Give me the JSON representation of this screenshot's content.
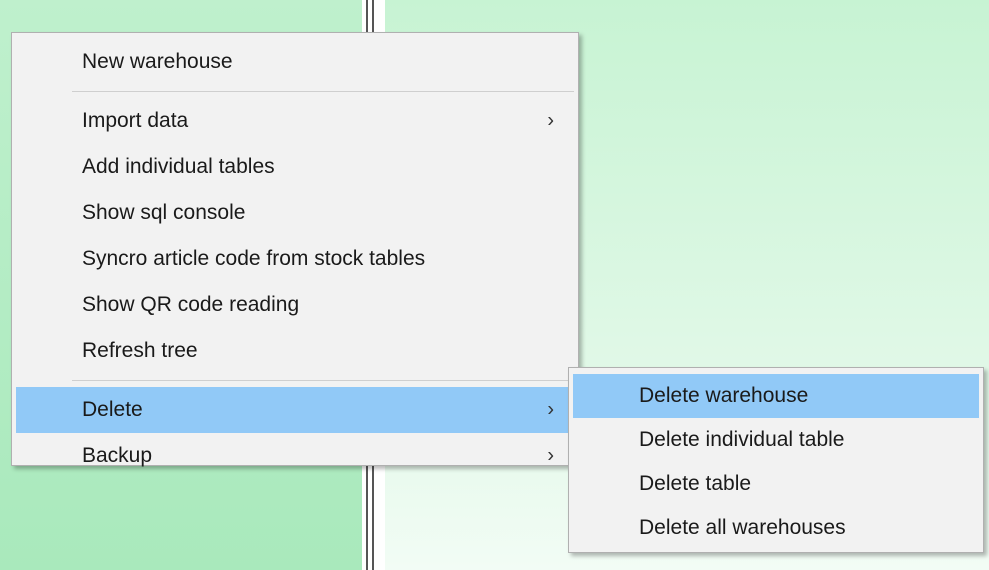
{
  "context_menu": {
    "items": [
      {
        "label": "New warehouse"
      },
      {
        "label": "Import data",
        "arrow": "›"
      },
      {
        "label": "Add individual tables"
      },
      {
        "label": "Show sql console"
      },
      {
        "label": "Syncro article code from stock tables"
      },
      {
        "label": "Show QR code reading"
      },
      {
        "label": "Refresh tree"
      },
      {
        "label": "Delete",
        "arrow": "›",
        "highlighted": true
      },
      {
        "label": "Backup",
        "arrow": "›"
      }
    ]
  },
  "submenu_delete": {
    "items": [
      {
        "label": "Delete warehouse",
        "highlighted": true
      },
      {
        "label": "Delete individual table"
      },
      {
        "label": "Delete table"
      },
      {
        "label": "Delete all warehouses"
      }
    ]
  },
  "colors": {
    "highlight": "#91c9f7",
    "menu_bg": "#f2f2f2",
    "left_panel": "#a9e9bc",
    "right_panel": "#c7f3d3"
  },
  "icons": {
    "submenu_arrow": "chevron-right-icon"
  }
}
